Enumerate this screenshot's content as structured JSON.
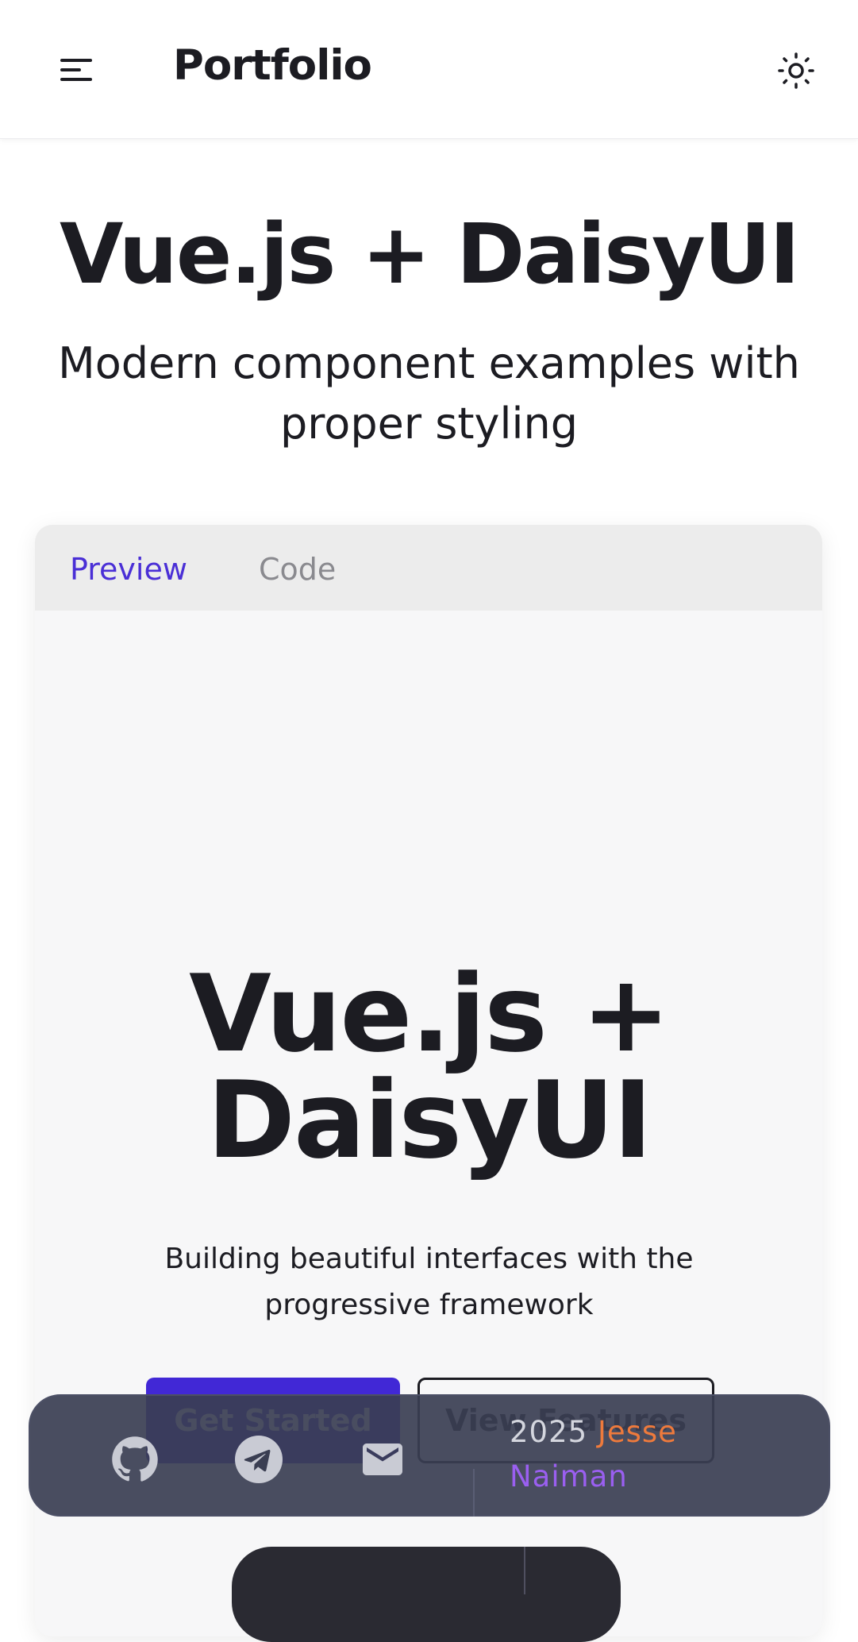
{
  "navbar": {
    "brand": "Portfolio",
    "menu_icon": "hamburger-menu-icon",
    "theme_icon": "sun-icon"
  },
  "hero": {
    "title": "Vue.js + DaisyUI",
    "subtitle": "Modern component examples with proper styling"
  },
  "card": {
    "tabs": [
      {
        "label": "Preview",
        "active": true
      },
      {
        "label": "Code",
        "active": false
      }
    ],
    "demo": {
      "title": "Vue.js + DaisyUI",
      "subtitle": "Building beautiful interfaces with the progressive framework",
      "primary_button": "Get Started",
      "secondary_button": "View Features"
    }
  },
  "footer": {
    "icons": [
      "github-icon",
      "telegram-icon",
      "mail-icon"
    ],
    "year": "2025",
    "author_first": "Jesse",
    "author_last": "Naiman"
  },
  "colors": {
    "accent": "#4a2fd6",
    "primary_button": "#4128d6",
    "footer_bg": "#3a3e52",
    "name_orange": "#ee7a3c",
    "name_purple": "#9a5ff0"
  }
}
